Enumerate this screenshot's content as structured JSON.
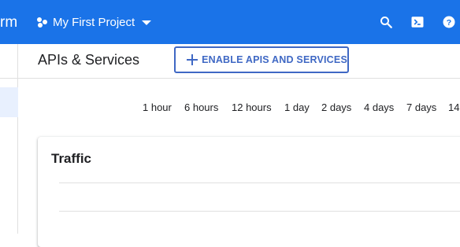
{
  "topbar": {
    "brand_fragment": "rm",
    "project": {
      "label": "My First Project",
      "icon": "project-dots-icon",
      "caret_icon": "caret-down-icon"
    },
    "icons": [
      "search-icon",
      "cloud-shell-icon",
      "help-icon"
    ],
    "background": "#1a73e8"
  },
  "header": {
    "title": "APIs & Services",
    "enable_button": {
      "label": "ENABLE APIS AND SERVICES",
      "icon": "plus-icon",
      "color": "#3f68c4"
    }
  },
  "time_range": {
    "options": [
      "1 hour",
      "6 hours",
      "12 hours",
      "1 day",
      "2 days",
      "4 days",
      "7 days",
      "14"
    ]
  },
  "card": {
    "title": "Traffic"
  }
}
